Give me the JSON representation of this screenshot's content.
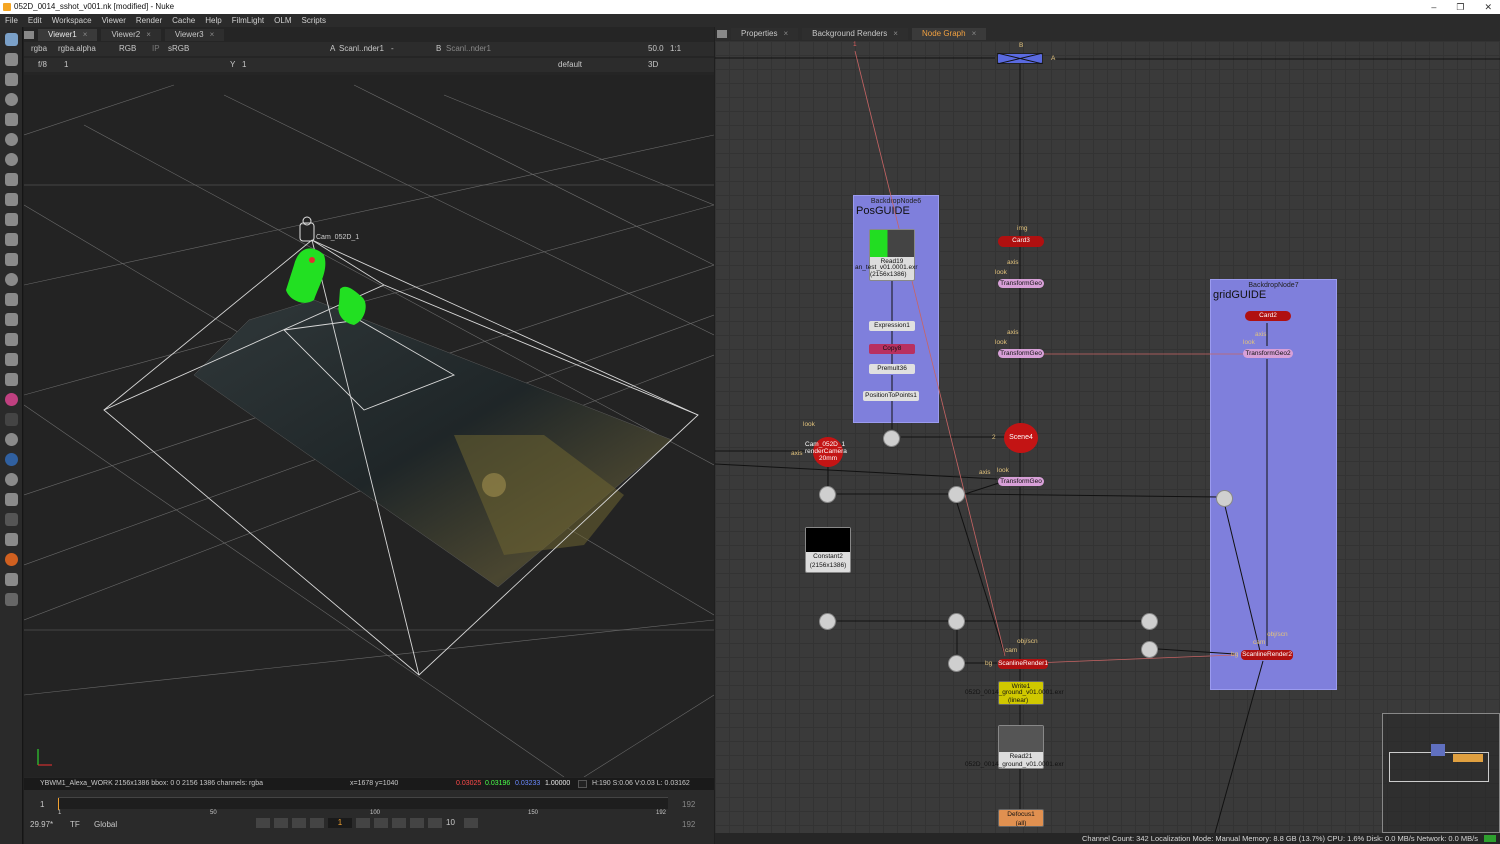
{
  "window": {
    "title": "052D_0014_sshot_v001.nk [modified] - Nuke",
    "minimize": "–",
    "maximize": "❐",
    "close": "✕"
  },
  "menu": [
    "File",
    "Edit",
    "Workspace",
    "Viewer",
    "Render",
    "Cache",
    "Help",
    "FilmLight",
    "OLM",
    "Scripts"
  ],
  "viewer": {
    "tabs": [
      {
        "label": "Viewer1"
      },
      {
        "label": "Viewer2"
      },
      {
        "label": "Viewer3"
      }
    ],
    "channels": "rgba",
    "alpha": "rgba.alpha",
    "colorspace_mode": "RGB",
    "ip": "IP",
    "lut": "sRGB",
    "input_a_label": "A",
    "input_a": "Scanl..nder1",
    "input_a_op": "-",
    "input_b_label": "B",
    "input_b": "Scanl..nder1",
    "zoom": "50.0",
    "proxy": "1:1",
    "fstop": "f/8",
    "frame_field": "1",
    "y_label": "Y",
    "y_value": "1",
    "lut_preset": "default",
    "view_mode": "3D",
    "camera_label": "Cam_052D_1",
    "info": "YBWM1_Alexa_WORK 2156x1386  bbox: 0 0 2156 1386 channels: rgba",
    "coords": "x=1678 y=1040",
    "rgb_r": "0.03025",
    "rgb_g": "0.03196",
    "rgb_b": "0.03233",
    "rgb_a": "1.00000",
    "hsv": "H:190 S:0.06 V:0.03  L: 0.03162"
  },
  "timeline": {
    "in_frame": "1",
    "ticks": [
      "1",
      "50",
      "100",
      "150",
      "192"
    ],
    "out_frame": "192",
    "fps": "29.97*",
    "tf": "TF",
    "range_mode": "Global",
    "current_frame": "1",
    "step": "10",
    "end_frame": "192"
  },
  "nodegraph": {
    "tabs": [
      {
        "label": "Properties"
      },
      {
        "label": "Background Renders"
      },
      {
        "label": "Node Graph"
      }
    ],
    "backdrop6": {
      "label": "BackdropNode6",
      "title": "PosGUIDE"
    },
    "backdrop7": {
      "label": "BackdropNode7",
      "title": "gridGUIDE"
    },
    "nodes": {
      "read19": "Read19",
      "read19_file": "an_test_v01.0001.exr",
      "read19_res": "(2156x1386)",
      "expression1": "Expression1",
      "copy": "Copy8",
      "premult": "Premult36",
      "position_to_points": "PositionToPoints1",
      "card3": "Card3",
      "transformgeo_a": "TransformGeo",
      "transformgeo_b": "TransformGeo",
      "scene4": "Scene4",
      "camera": "Cam_052D_1",
      "camera_sub": "renderCamera",
      "camera_focal": "20mm",
      "transformgeo_c": "TransformGeo",
      "constant2": "Constant2",
      "constant2_res": "(2156x1386)",
      "scanline": "ScanlineRender1",
      "write1": "Write1",
      "write1_file": "052D_0014_ground_v01.0001.exr",
      "write1_cs": "(linear)",
      "read21": "Read21",
      "read21_file": "052D_0014_ground_v01.0001.exr",
      "defocus": "Defocus1",
      "defocus_sub": "(all)",
      "card_grid": "Card2",
      "transformgeo2": "TransformGeo2",
      "scanline2": "ScanlineRender2"
    },
    "labels": {
      "img": "img",
      "axis": "axis",
      "look": "look",
      "cam": "cam",
      "objscn": "obj/scn",
      "bg": "bg",
      "b": "B",
      "a": "A",
      "one": "1",
      "two": "2"
    }
  },
  "status": "Channel Count: 342  Localization Mode: Manual  Memory: 8.8 GB (13.7%)  CPU: 1.6%  Disk: 0.0 MB/s  Network: 0.0 MB/s"
}
